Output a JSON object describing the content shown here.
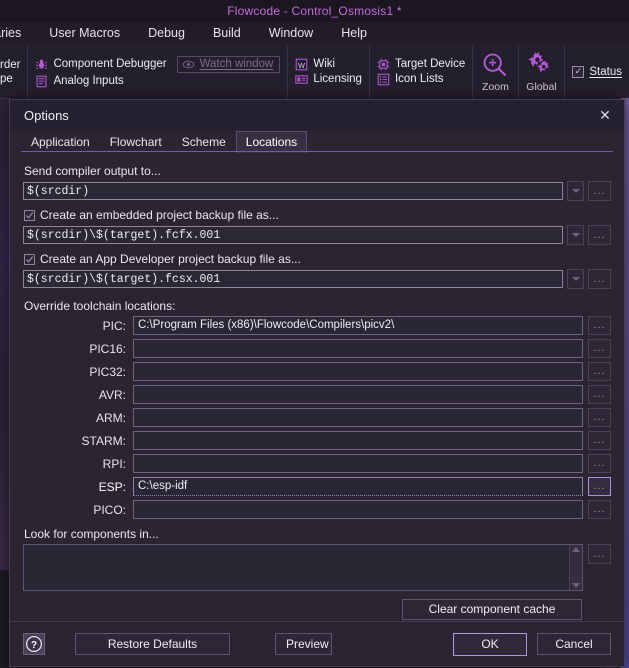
{
  "app": {
    "title": "Flowcode - Control_Osmosis1 *",
    "menus": [
      "raries",
      "User Macros",
      "Debug",
      "Build",
      "Window",
      "Help"
    ],
    "toolbar": {
      "group_left": [
        "rder",
        "pe"
      ],
      "group_debug": [
        {
          "label": "Component Debugger",
          "icon": "bug-icon"
        },
        {
          "label": "Analog Inputs",
          "icon": "analog-inputs-icon"
        }
      ],
      "watch_window": {
        "label": "Watch window",
        "icon": "eye-icon"
      },
      "group_help": [
        {
          "label": "Wiki",
          "icon": "wiki-icon"
        },
        {
          "label": "Licensing",
          "icon": "licensing-icon"
        }
      ],
      "group_device": [
        {
          "label": "Target Device",
          "icon": "chip-icon"
        },
        {
          "label": "Icon Lists",
          "icon": "list-icon"
        }
      ],
      "zoom_button": {
        "label": "Zoom",
        "icon": "zoom-in-icon"
      },
      "global_button": {
        "label": "Global",
        "icon": "gears-icon"
      },
      "status_checkbox": {
        "label": "Status",
        "checked": true
      }
    }
  },
  "dialog": {
    "title": "Options",
    "close_label": "✕",
    "tabs": [
      {
        "label": "Application",
        "active": false
      },
      {
        "label": "Flowchart",
        "active": false
      },
      {
        "label": "Scheme",
        "active": false
      },
      {
        "label": "Locations",
        "active": true
      }
    ],
    "compiler_output": {
      "label": "Send compiler output to...",
      "value": "$(srcdir)",
      "browse_label": "...",
      "dropdown_label": "▼"
    },
    "embedded_backup": {
      "checkbox_label": "Create an embedded project backup file as...",
      "checked": true,
      "value": "$(srcdir)\\$(target).fcfx.001",
      "browse_label": "..."
    },
    "appdev_backup": {
      "checkbox_label": "Create an App Developer project backup file as...",
      "checked": true,
      "value": "$(srcdir)\\$(target).fcsx.001",
      "browse_label": "..."
    },
    "toolchain": {
      "label": "Override toolchain locations:",
      "browse_label": "...",
      "rows": [
        {
          "label": "PIC:",
          "value": "C:\\Program Files (x86)\\Flowcode\\Compilers\\picv2\\",
          "focused": false
        },
        {
          "label": "PIC16:",
          "value": "",
          "focused": false
        },
        {
          "label": "PIC32:",
          "value": "",
          "focused": false
        },
        {
          "label": "AVR:",
          "value": "",
          "focused": false
        },
        {
          "label": "ARM:",
          "value": "",
          "focused": false
        },
        {
          "label": "STARM:",
          "value": "",
          "focused": false
        },
        {
          "label": "RPI:",
          "value": "",
          "focused": false
        },
        {
          "label": "ESP:",
          "value": "C:\\esp-idf",
          "focused": true
        },
        {
          "label": "PICO:",
          "value": "",
          "focused": false
        }
      ]
    },
    "components": {
      "label": "Look for components in...",
      "value": "",
      "browse_label": "...",
      "clear_cache_label": "Clear component cache"
    },
    "footer": {
      "help_label": "?",
      "restore_defaults_label": "Restore Defaults",
      "preview_label": "Preview",
      "ok_label": "OK",
      "cancel_label": "Cancel"
    }
  },
  "colors": {
    "accent_purple": "#c46ce0",
    "dialog_bg": "#2a2531",
    "tab_underline": "#6a5ac6",
    "focus_border": "#a094dd"
  }
}
